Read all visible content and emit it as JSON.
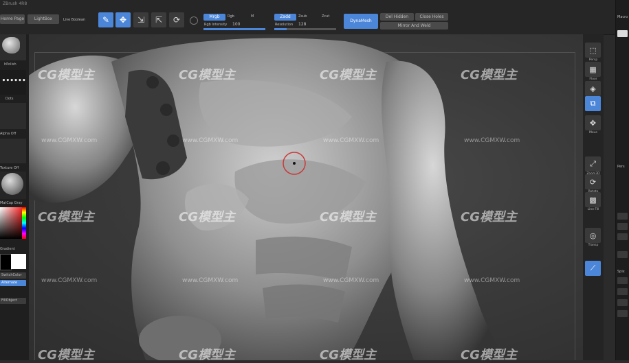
{
  "window": {
    "title": "ZBrush 4R8"
  },
  "toolbar": {
    "home_page": "Home Page",
    "lightbox": "LightBox",
    "live_boolean": "Live Boolean",
    "edit_label": "Edit",
    "draw_label": "Draw",
    "move_label": "Move",
    "scale_label": "Scale",
    "rotate_label": "Rotate",
    "mrgb": "Mrgb",
    "rgb": "Rgb",
    "m": "M",
    "zadd": "Zadd",
    "zsub": "Zsub",
    "zcut": "Zcut",
    "rgb_intensity_label": "Rgb Intensity",
    "rgb_intensity_value": "100",
    "resolution_label": "Resolution",
    "resolution_value": "128",
    "dynamesh": "DynaMesh",
    "del_hidden": "Del Hidden",
    "close_holes": "Close Holes",
    "mirror_and_weld": "Mirror And Weld"
  },
  "left_panel": {
    "brush_name": "hPolish",
    "stroke_name": "Dots",
    "alpha_label": "Alpha Off",
    "texture_label": "Texture Off",
    "material_label": "MatCap Gray",
    "gradient_label": "Gradient",
    "switch_color": "SwitchColor",
    "alternate": "Alternate",
    "fill_object": "FillObject"
  },
  "right_shelf": [
    {
      "icon": "persp-icon",
      "label": "Persp"
    },
    {
      "icon": "floor-icon",
      "label": "Floor"
    },
    {
      "icon": "local-icon",
      "label": "Local"
    },
    {
      "icon": "frame-icon",
      "label": "Frame"
    },
    {
      "icon": "move-icon",
      "label": "Move"
    },
    {
      "icon": "zoom3d-icon",
      "label": "Zoom3D"
    },
    {
      "icon": "rotate-icon",
      "label": "Rotate"
    },
    {
      "icon": "line-fill-icon",
      "label": "Line Fill"
    },
    {
      "icon": "transp-icon",
      "label": "Transp"
    },
    {
      "icon": "solo-icon",
      "label": "Solo"
    }
  ],
  "far_right": {
    "top_label": "Macro",
    "rows": [
      "Pers",
      "Floor",
      "Sym",
      "Sym",
      "Spix",
      "Nm"
    ]
  },
  "watermark": {
    "brand": "CG模型主",
    "url": "www.CGMXW.com"
  }
}
